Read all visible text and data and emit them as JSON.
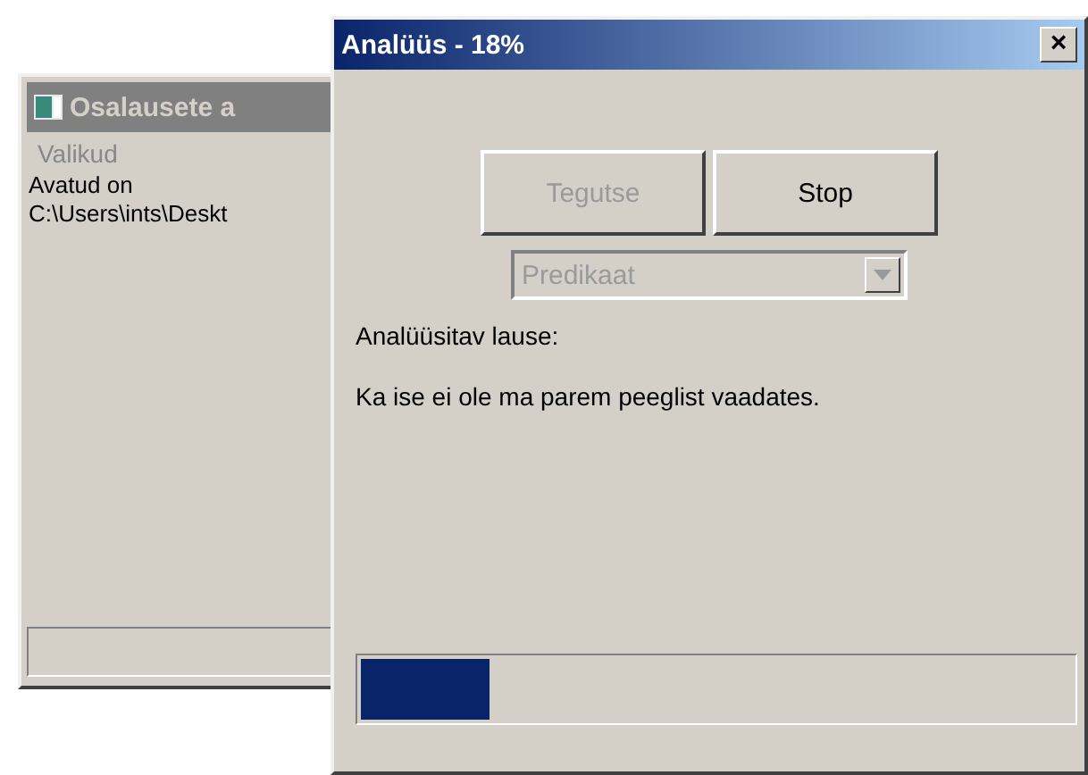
{
  "back_window": {
    "title": "Osalausete a",
    "active": false,
    "menu": [
      {
        "label": "Valikud",
        "disabled": true
      }
    ],
    "text_lines": [
      "Avatud on",
      "C:\\Users\\ints\\Deskt"
    ]
  },
  "dialog": {
    "title": "Analüüs - 18%",
    "active": true,
    "close": "×",
    "buttons": [
      {
        "label": "Tegutse",
        "disabled": true
      },
      {
        "label": "Stop",
        "disabled": false
      }
    ],
    "dropdown": {
      "value": "Predikaat",
      "disabled": true
    },
    "label": "Analüüsitav lause:",
    "sentence": "Ka ise ei ole ma parem peeglist vaadates.",
    "progress": {
      "level": 0.18
    }
  }
}
